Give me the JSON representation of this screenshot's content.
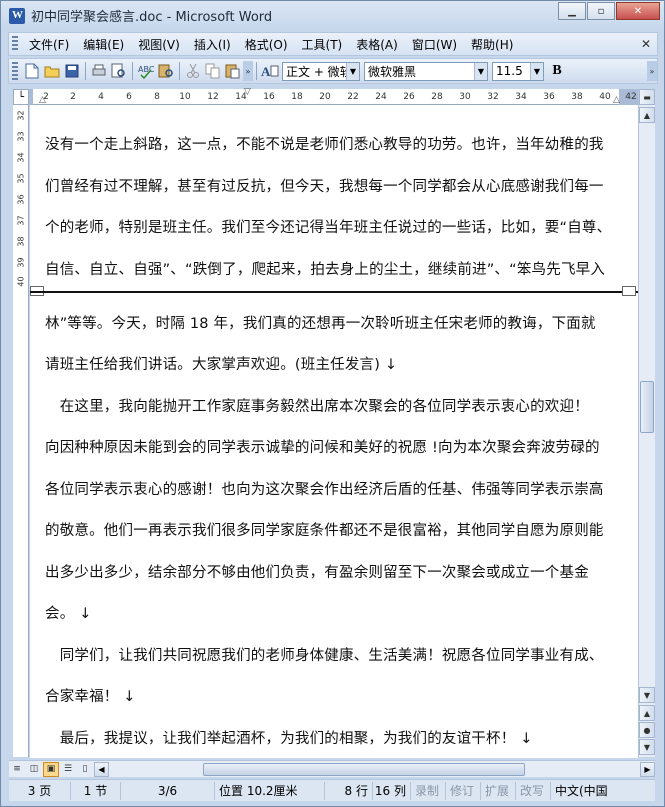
{
  "window": {
    "title": "初中同学聚会感言.doc - Microsoft Word",
    "minimize": "▁",
    "restore": "▫",
    "close": "✕"
  },
  "menu": {
    "items": [
      "文件(F)",
      "编辑(E)",
      "视图(V)",
      "插入(I)",
      "格式(O)",
      "工具(T)",
      "表格(A)",
      "窗口(W)",
      "帮助(H)"
    ],
    "close_doc": "✕"
  },
  "toolbar": {
    "style_value": "正文 + 微软",
    "font_value": "微软雅黑",
    "size_value": "11.5",
    "bold_label": "B"
  },
  "ruler": {
    "ticks": [
      "2",
      "2",
      "4",
      "6",
      "8",
      "10",
      "12",
      "14",
      "16",
      "18",
      "20",
      "22",
      "24",
      "26",
      "28",
      "30",
      "32",
      "34",
      "36",
      "38",
      "40",
      "42"
    ],
    "vticks": [
      "32",
      "33",
      "34",
      "35",
      "36",
      "37",
      "38",
      "39",
      "40"
    ]
  },
  "document": {
    "lines": [
      "没有一个走上斜路，这一点，不能不说是老师们悉心教导的功劳。也许，当年幼稚的我",
      "们曾经有过不理解，甚至有过反抗，但今天，我想每一个同学都会从心底感谢我们每一",
      "个的老师，特别是班主任。我们至今还记得当年班主任说过的一些话，比如，要“自尊、",
      "自信、自立、自强”、“跌倒了，爬起来，拍去身上的尘土，继续前进”、“笨鸟先飞早入",
      "林”等等。今天，时隔 18 年，我们真的还想再一次聆听班主任宋老师的教诲，下面就",
      "请班主任给我们讲话。大家掌声欢迎。(班主任发言) ↓",
      "　在这里，我向能抛开工作家庭事务毅然出席本次聚会的各位同学表示衷心的欢迎！",
      "向因种种原因未能到会的同学表示诚挚的问候和美好的祝愿 !向为本次聚会奔波劳碌的",
      "各位同学表示衷心的感谢！也向为这次聚会作出经济后盾的任基、伟强等同学表示崇高",
      "的敬意。他们一再表示我们很多同学家庭条件都还不是很富裕，其他同学自愿为原则能",
      "出多少出多少，结余部分不够由他们负责，有盈余则留至下一次聚会或成立一个基金",
      "会。 ↓",
      "　同学们，让我们共同祝愿我们的老师身体健康、生活美满！祝愿各位同学事业有成、",
      "合家幸福！ ↓",
      "　最后，我提议，让我们举起酒杯，为我们的相聚，为我们的友谊干杯！ ↓"
    ]
  },
  "status": {
    "page": "3 页",
    "section": "1 节",
    "page_of": "3/6",
    "position": "位置 10.2厘米",
    "line": "8 行",
    "column": "16 列",
    "rec": "录制",
    "trk": "修订",
    "ext": "扩展",
    "ovr": "改写",
    "language": "中文(中国"
  },
  "colors": {
    "chrome": "#c6d7ec",
    "toolbar": "#d6e3f3",
    "text": "#111111"
  }
}
